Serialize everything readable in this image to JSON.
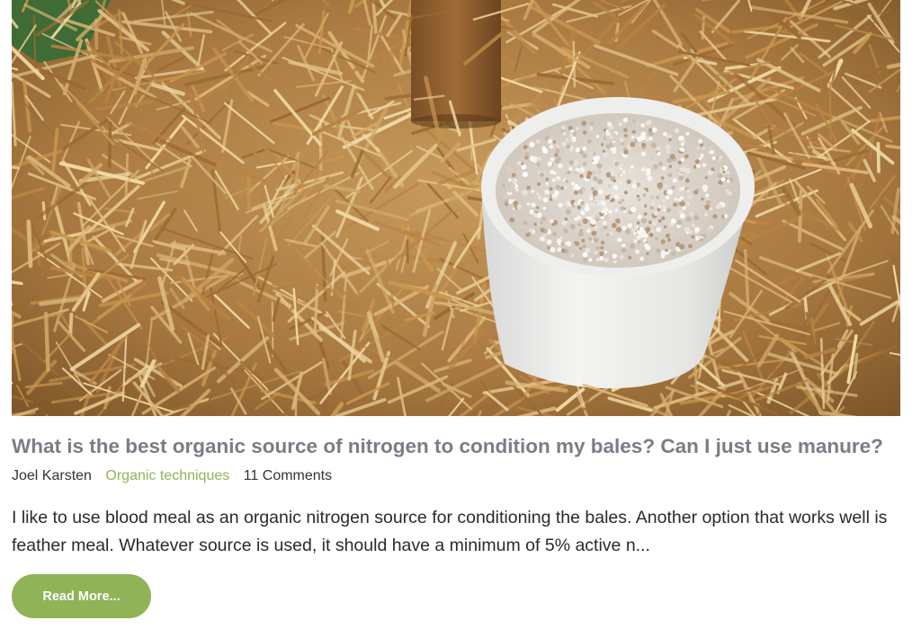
{
  "post": {
    "image_alt": "White tub of granular fertilizer sitting on a straw bale",
    "title": "What is the best organic source of nitrogen to condition my bales? Can I just use manure?",
    "author": "Joel Karsten",
    "category": "Organic techniques",
    "comments": "11 Comments",
    "excerpt": "I like to use blood meal as an organic nitrogen source for conditioning the bales.  Another option that works well is feather meal.  Whatever source is used, it should have a minimum of 5% active n...",
    "read_more_label": "Read More..."
  },
  "colors": {
    "title": "#7c7c87",
    "accent": "#8fb356",
    "text": "#2a2a2a"
  }
}
